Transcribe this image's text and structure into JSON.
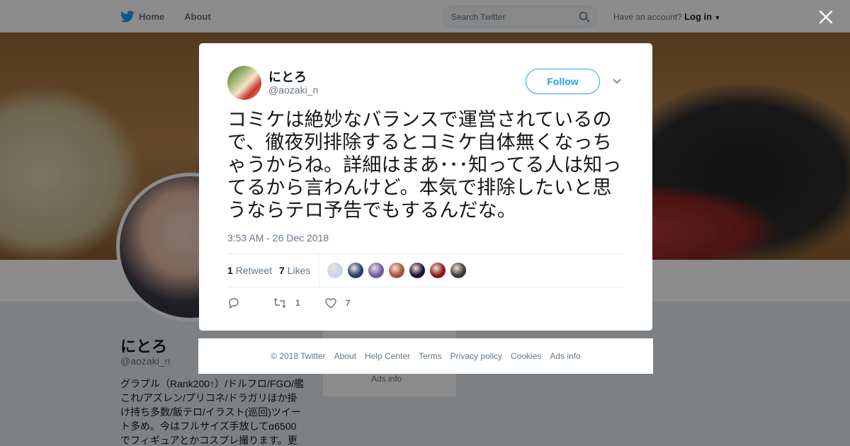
{
  "topbar": {
    "home_label": "Home",
    "about_label": "About",
    "search_placeholder": "Search Twitter",
    "account_prompt": "Have an account?",
    "login_label": "Log in"
  },
  "profile": {
    "name": "にとろ",
    "handle": "@aozaki_n",
    "bio": "グラブル（Rank200↑）/ドルフロ/FGO/艦これ/アズレン/プリコネ/ドラガリほか掛け持ち多数/飯テロ/イラスト(巡回)ツイート多め。今はフルサイズ手放してα6500でフィギュアとかコスプレ撮ります。更",
    "side_card_text": "Ads info"
  },
  "tweet": {
    "author_name": "にとろ",
    "author_handle": "@aozaki_n",
    "follow_label": "Follow",
    "text": "コミケは絶妙なバランスで運営されているので、徹夜列排除するとコミケ自体無くなっちゃうからね。詳細はまあ･･･知ってる人は知ってるから言わんけど。本気で排除したいと思うならテロ予告でもするんだな。",
    "timestamp": "3:53 AM - 26 Dec 2018",
    "retweet_count": "1",
    "retweet_label": "Retweet",
    "like_count": "7",
    "like_label": "Likes",
    "likers": [
      "#c9d4e6",
      "#2b3b6e",
      "#6a5aa8",
      "#a84f3a",
      "#1a1030",
      "#8a1a1a",
      "#3a3a3a"
    ],
    "action_retweet_count": "1",
    "action_like_count": "7"
  },
  "footer": {
    "links": [
      "© 2018 Twitter",
      "About",
      "Help Center",
      "Terms",
      "Privacy policy",
      "Cookies",
      "Ads info"
    ]
  },
  "colors": {
    "brand_blue": "#1da1f2",
    "secondary_text": "#657786"
  }
}
